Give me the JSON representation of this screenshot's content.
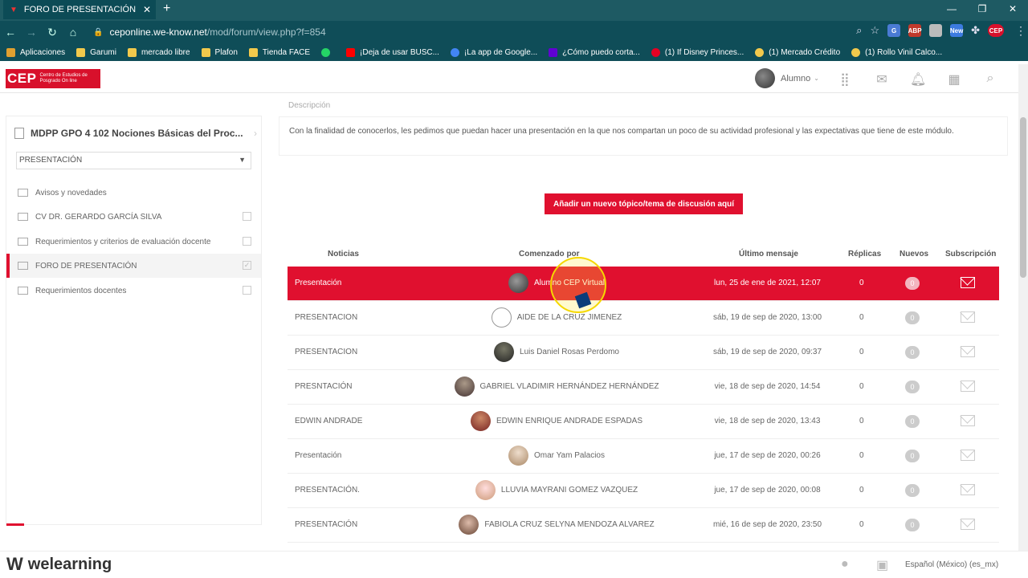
{
  "browser": {
    "tab_title": "FORO DE PRESENTACIÓN",
    "url_host": "ceponline.we-know.net",
    "url_path": "/mod/forum/view.php?f=854",
    "bookmarks": [
      {
        "label": "Aplicaciones",
        "color": "#e0a030"
      },
      {
        "label": "Garumi",
        "color": "#f2c94c"
      },
      {
        "label": "mercado libre",
        "color": "#f2c94c"
      },
      {
        "label": "Plafon",
        "color": "#f2c94c"
      },
      {
        "label": "Tienda FACE",
        "color": "#f2c94c"
      },
      {
        "label": "",
        "color": "#25d366"
      },
      {
        "label": "¡Deja de usar BUSC...",
        "color": "#ff0000"
      },
      {
        "label": "¡La app de Google...",
        "color": "#4285f4"
      },
      {
        "label": "¿Cómo puedo corta...",
        "color": "#6001d2"
      },
      {
        "label": "(1) If Disney Princes...",
        "color": "#e60023"
      },
      {
        "label": "(1) Mercado Crédito",
        "color": "#f2c94c"
      },
      {
        "label": "(1) Rollo Vinil Calco...",
        "color": "#f2c94c"
      }
    ],
    "ext_abp": "ABP",
    "ext_new": "New",
    "ext_cep": "CEP"
  },
  "header": {
    "logo": "CEP",
    "logo_sub": "Centro de Estudios de Posgrado On line",
    "user": "Alumno"
  },
  "sidebar": {
    "course": "MDPP GPO 4 102 Nociones Básicas del Proc...",
    "section": "PRESENTACIÓN",
    "items": [
      {
        "label": "Avisos y novedades"
      },
      {
        "label": "CV DR. GERARDO GARCÍA SILVA"
      },
      {
        "label": "Requerimientos y criterios de evaluación docente"
      },
      {
        "label": "FORO DE PRESENTACIÓN"
      },
      {
        "label": "Requerimientos docentes"
      }
    ]
  },
  "main": {
    "desc_label": "Descripción",
    "description": "Con la finalidad de conocerlos, les pedimos que puedan hacer una presentación en la que nos compartan un poco de su actividad profesional y las expectativas que tiene de este módulo.",
    "add_button": "Añadir un nuevo tópico/tema de discusión aquí",
    "columns": {
      "topic": "Noticias",
      "author": "Comenzado por",
      "last": "Último mensaje",
      "replies": "Réplicas",
      "new": "Nuevos",
      "sub": "Subscripción"
    },
    "rows": [
      {
        "topic": "Presentación",
        "author": "Alumno CEP Virtual",
        "date": "lun, 25 de ene de 2021, 12:07",
        "replies": "0",
        "new": "0"
      },
      {
        "topic": "PRESENTACION",
        "author": "AIDE DE LA CRUZ JIMENEZ",
        "date": "sáb, 19 de sep de 2020, 13:00",
        "replies": "0",
        "new": "0"
      },
      {
        "topic": "PRESENTACION",
        "author": "Luis Daniel Rosas Perdomo",
        "date": "sáb, 19 de sep de 2020, 09:37",
        "replies": "0",
        "new": "0"
      },
      {
        "topic": "PRESNTACIÓN",
        "author": "GABRIEL VLADIMIR HERNÁNDEZ HERNÁNDEZ",
        "date": "vie, 18 de sep de 2020, 14:54",
        "replies": "0",
        "new": "0"
      },
      {
        "topic": "EDWIN ANDRADE",
        "author": "EDWIN ENRIQUE ANDRADE ESPADAS",
        "date": "vie, 18 de sep de 2020, 13:43",
        "replies": "0",
        "new": "0"
      },
      {
        "topic": "Presentación",
        "author": "Omar Yam Palacios",
        "date": "jue, 17 de sep de 2020, 00:26",
        "replies": "0",
        "new": "0"
      },
      {
        "topic": "PRESENTACIÓN.",
        "author": "LLUVIA MAYRANI GOMEZ VAZQUEZ",
        "date": "jue, 17 de sep de 2020, 00:08",
        "replies": "0",
        "new": "0"
      },
      {
        "topic": "PRESENTACIÓN",
        "author": "FABIOLA CRUZ SELYNA MENDOZA ALVAREZ",
        "date": "mié, 16 de sep de 2020, 23:50",
        "replies": "0",
        "new": "0"
      }
    ]
  },
  "footer": {
    "brand": "welearning",
    "language": "Español (México) (es_mx)"
  },
  "colors": {
    "accent": "#e0102f",
    "chrome": "#0f4d58"
  }
}
